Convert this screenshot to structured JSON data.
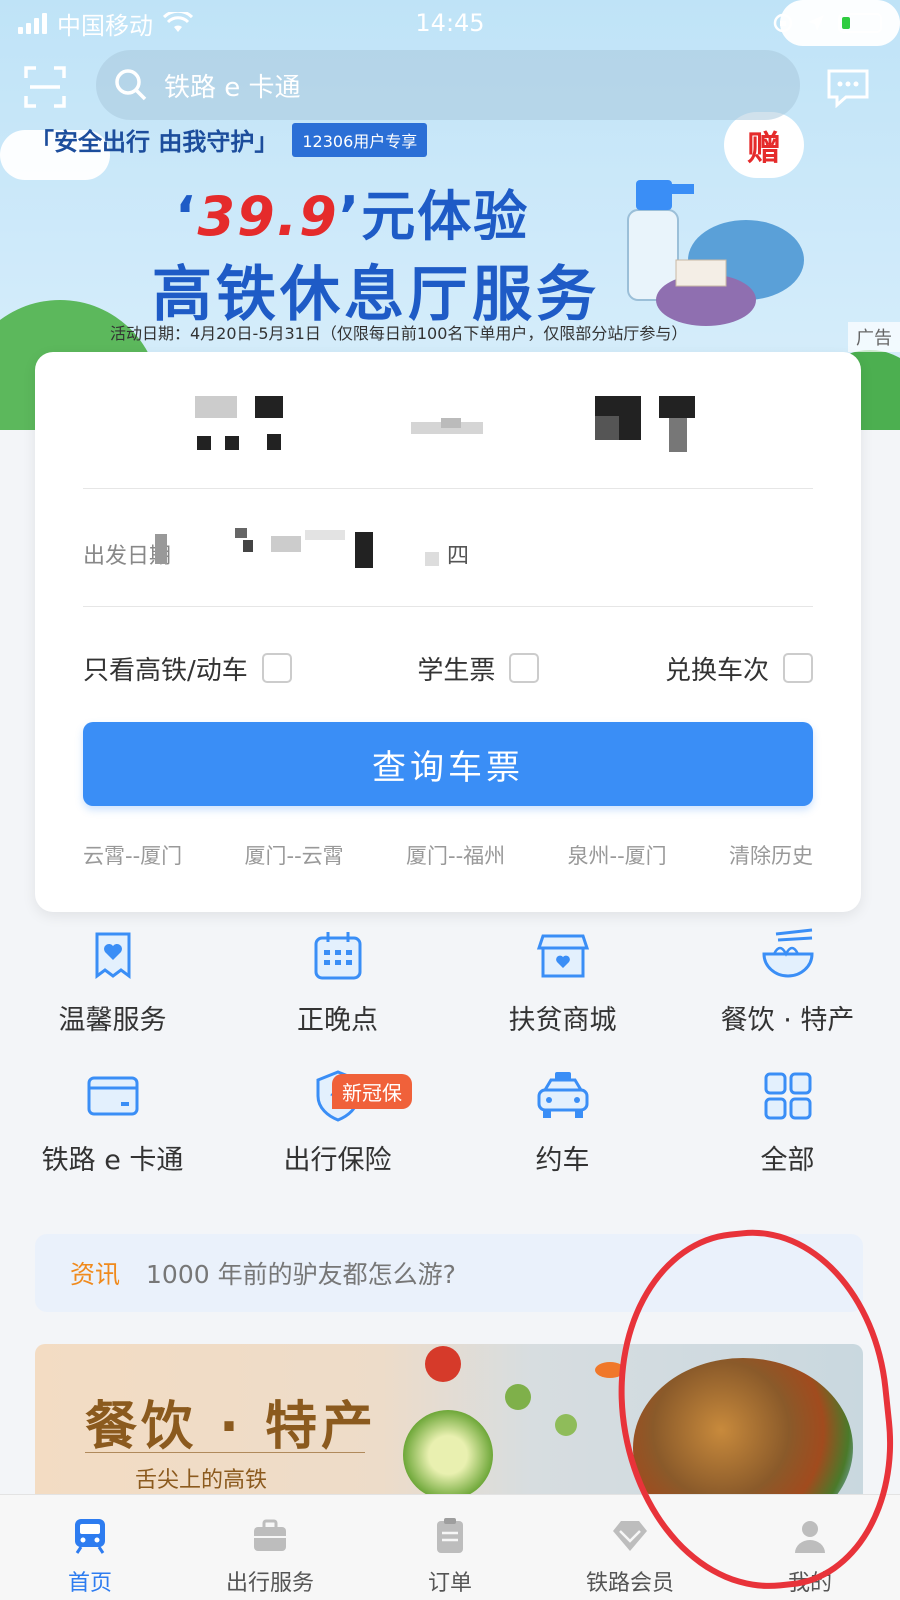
{
  "status_bar": {
    "carrier": "中国移动",
    "time": "14:45"
  },
  "search": {
    "label": "铁路 e 卡通"
  },
  "banner": {
    "slogan": "「安全出行 由我守护」",
    "tag": "12306用户专享",
    "price_prefix": "‘",
    "price_value": "39.9",
    "price_suffix": "’元体验",
    "title": "高铁休息厅服务",
    "note": "活动日期：4月20日-5月31日（仅限每日前100名下单用户，仅限部分站厅参与）",
    "gift": "赠",
    "ad_label": "广告"
  },
  "ticket": {
    "date_label": "出发日期",
    "weekday": "四",
    "options": [
      {
        "label": "只看高铁/动车",
        "checked": false
      },
      {
        "label": "学生票",
        "checked": false
      },
      {
        "label": "兑换车次",
        "checked": false
      }
    ],
    "query_button": "查询车票",
    "history": [
      "云霄--厦门",
      "厦门--云霄",
      "厦门--福州",
      "泉州--厦门"
    ],
    "clear_history": "清除历史"
  },
  "services": [
    {
      "label": "温馨服务",
      "icon": "heart-doc-icon"
    },
    {
      "label": "正晚点",
      "icon": "calendar-icon"
    },
    {
      "label": "扶贫商城",
      "icon": "shop-icon"
    },
    {
      "label": "餐饮 · 特产",
      "icon": "noodle-bowl-icon"
    },
    {
      "label": "铁路 e 卡通",
      "icon": "card-icon"
    },
    {
      "label": "出行保险",
      "icon": "shield-icon"
    },
    {
      "label": "约车",
      "icon": "car-icon"
    },
    {
      "label": "全部",
      "icon": "grid-icon"
    }
  ],
  "insurance_badge": "新冠保",
  "news": {
    "tag": "资讯",
    "text": "1000 年前的驴友都怎么游?"
  },
  "food_banner": {
    "title": "餐饮 · 特产",
    "subtitle": "舌尖上的高铁"
  },
  "bottom_nav": [
    {
      "label": "首页",
      "active": true
    },
    {
      "label": "出行服务",
      "active": false
    },
    {
      "label": "订单",
      "active": false
    },
    {
      "label": "铁路会员",
      "active": false
    },
    {
      "label": "我的",
      "active": false
    }
  ],
  "colors": {
    "primary": "#3a8ef6",
    "nav_active": "#2d7cf0",
    "accent_orange": "#f08a1c",
    "badge_red": "#f0613a",
    "annotation_red": "#e8333a"
  }
}
